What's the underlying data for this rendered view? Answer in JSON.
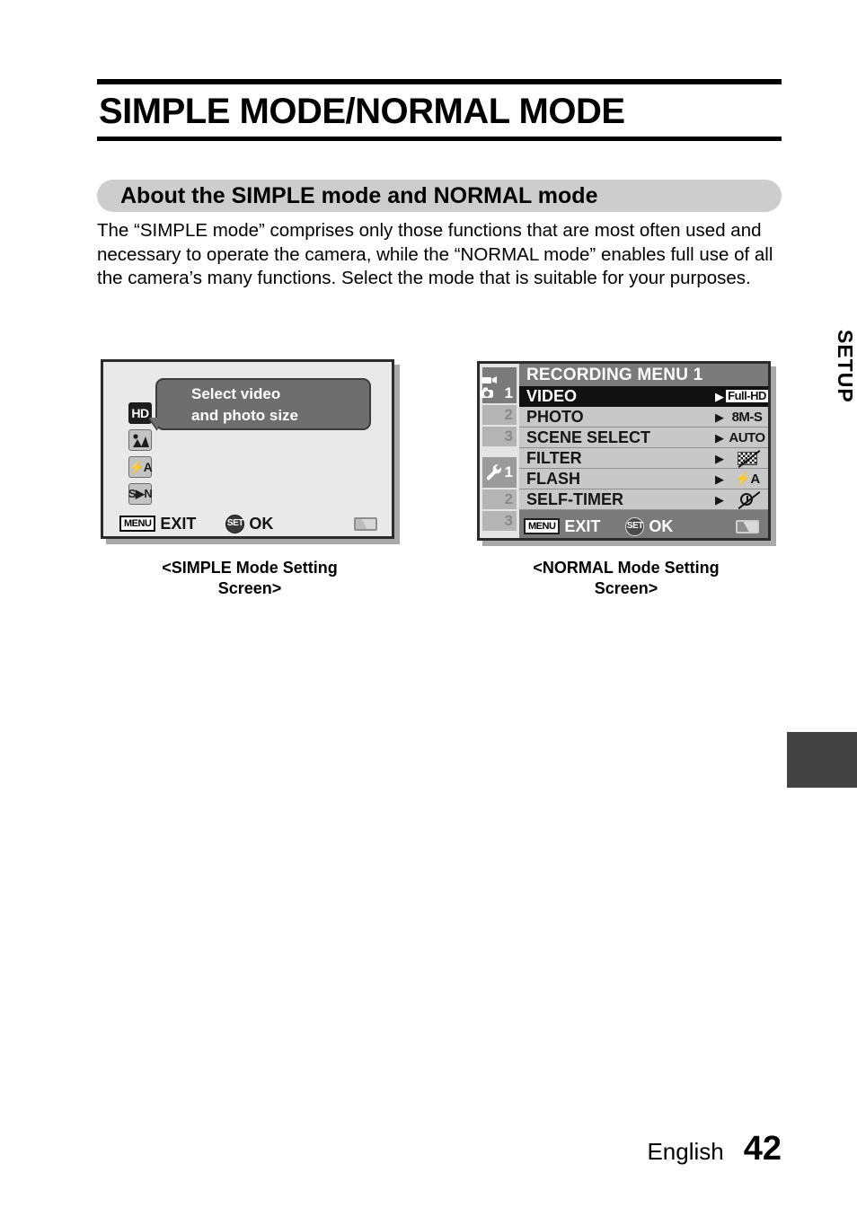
{
  "page": {
    "title": "SIMPLE MODE/NORMAL MODE",
    "section_heading": "About the SIMPLE mode and NORMAL mode",
    "intro_paragraph": "The “SIMPLE mode” comprises only those functions that are most often used and necessary to operate the camera, while the “NORMAL mode” enables full use of all the camera’s many functions. Select the mode that is suitable for your purposes.",
    "side_tab_label": "SETUP",
    "footer": {
      "language": "English",
      "page_number": "42"
    }
  },
  "simple_screen": {
    "caption": "<SIMPLE Mode Setting\nScreen>",
    "bubble_text": "Select video\nand photo size",
    "osd_icons": [
      {
        "name": "hd-badge",
        "label": "HD",
        "style": "dark"
      },
      {
        "name": "scene-select-icon",
        "label": "",
        "style": "light"
      },
      {
        "name": "flash-auto-icon",
        "label": "⚡A",
        "style": "light"
      },
      {
        "name": "simple-normal-toggle-icon",
        "label": "S▶N",
        "style": "light"
      }
    ],
    "status_bar": {
      "menu_badge": "MENU",
      "menu_action": "EXIT",
      "set_badge": "SET",
      "set_action": "OK"
    }
  },
  "normal_screen": {
    "caption": "<NORMAL Mode Setting\nScreen>",
    "menu_title": "RECORDING MENU 1",
    "tabs": [
      {
        "name": "tab-recording-1",
        "label": "1",
        "icon": "video-camera-icon",
        "state": "active"
      },
      {
        "name": "tab-recording-2",
        "label": "2",
        "icon": "",
        "state": "inactive"
      },
      {
        "name": "tab-recording-3",
        "label": "3",
        "icon": "",
        "state": "inactive"
      },
      {
        "name": "tab-setup-1",
        "label": "1",
        "icon": "wrench-icon",
        "state": "active-wrench"
      },
      {
        "name": "tab-setup-2",
        "label": "2",
        "icon": "",
        "state": "inactive"
      },
      {
        "name": "tab-setup-3",
        "label": "3",
        "icon": "",
        "state": "inactive"
      }
    ],
    "menu_rows": [
      {
        "name": "menu-row-video",
        "label": "VIDEO",
        "value": "Full-HD",
        "value_kind": "fullhd",
        "selected": true
      },
      {
        "name": "menu-row-photo",
        "label": "PHOTO",
        "value": "8M-S",
        "value_kind": "text",
        "selected": false
      },
      {
        "name": "menu-row-scene-select",
        "label": "SCENE SELECT",
        "value": "AUTO",
        "value_kind": "text",
        "selected": false
      },
      {
        "name": "menu-row-filter",
        "label": "FILTER",
        "value": "",
        "value_kind": "filter-off",
        "selected": false
      },
      {
        "name": "menu-row-flash",
        "label": "FLASH",
        "value": "⚡A",
        "value_kind": "text",
        "selected": false
      },
      {
        "name": "menu-row-self-timer",
        "label": "SELF-TIMER",
        "value": "",
        "value_kind": "timer-off",
        "selected": false
      }
    ],
    "arrow_glyph": "▶",
    "status_bar": {
      "menu_badge": "MENU",
      "menu_action": "EXIT",
      "set_badge": "SET",
      "set_action": "OK"
    }
  },
  "colors": {
    "banner_gray": "#cdcdcd",
    "screen_bg_simple": "#e9e9e9",
    "screen_bg_normal": "#7a7a7a",
    "menu_row_gray": "#c8c8c8",
    "selected_black": "#111111",
    "setup_tab_dark": "#434343"
  }
}
